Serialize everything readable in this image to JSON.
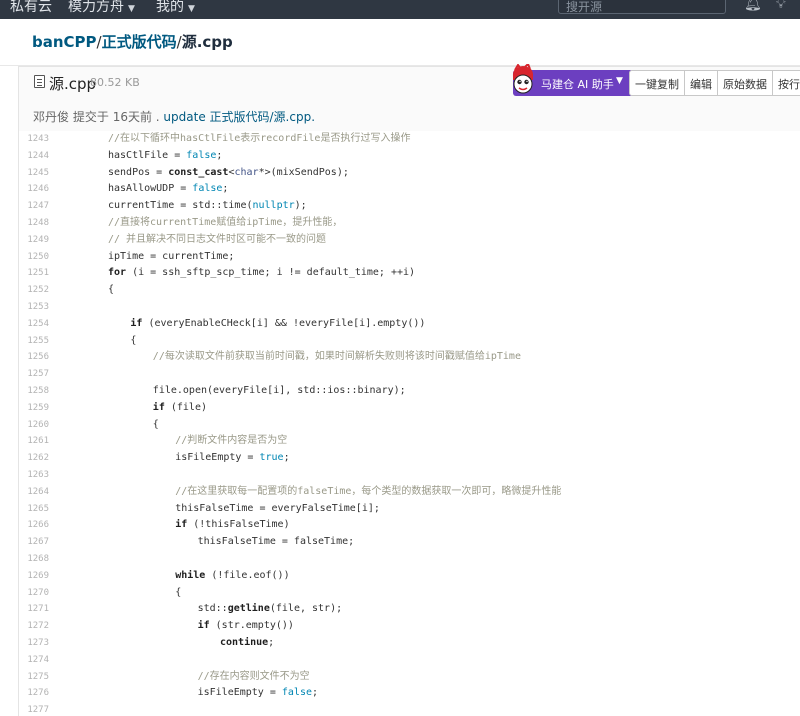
{
  "nav": {
    "items": [
      {
        "label": "私有云",
        "has_caret": false
      },
      {
        "label": "模力方舟",
        "has_caret": true
      },
      {
        "label": "我的",
        "has_caret": true
      }
    ],
    "search_placeholder": "搜开源",
    "icons": [
      "bell-icon",
      "lightbulb-icon"
    ]
  },
  "path": {
    "owner": "banCPP",
    "separator": "/",
    "folder": "正式版代码",
    "file": "源.cpp"
  },
  "file": {
    "name": "源.cpp",
    "size": "80.52 KB",
    "ai_button_label": "马建仓 AI 助手",
    "actions": [
      "一键复制",
      "编辑",
      "原始数据",
      "按行查看"
    ],
    "commit": {
      "author": "邓丹俊",
      "action": "提交于",
      "time": "16天前",
      "separator": " . ",
      "message": "update 正式版代码/源.cpp."
    }
  },
  "code_lines": [
    {
      "num": "1243",
      "tokens": [
        {
          "t": "//在以下循环中hasCtlFile表示recordFile是否执行过写入操作",
          "c": "cmt"
        }
      ],
      "indent": 0
    },
    {
      "num": "1244",
      "tokens": [
        {
          "t": "hasCtlFile = ",
          "c": ""
        },
        {
          "t": "false",
          "c": "bool"
        },
        {
          "t": ";",
          "c": ""
        }
      ],
      "indent": 0
    },
    {
      "num": "1245",
      "tokens": [
        {
          "t": "sendPos = ",
          "c": ""
        },
        {
          "t": "const_cast",
          "c": "kw"
        },
        {
          "t": "<",
          "c": ""
        },
        {
          "t": "char",
          "c": "kt"
        },
        {
          "t": "*>(mixSendPos);",
          "c": ""
        }
      ],
      "indent": 0
    },
    {
      "num": "1246",
      "tokens": [
        {
          "t": "hasAllowUDP = ",
          "c": ""
        },
        {
          "t": "false",
          "c": "bool"
        },
        {
          "t": ";",
          "c": ""
        }
      ],
      "indent": 0
    },
    {
      "num": "1247",
      "tokens": [
        {
          "t": "currentTime = std::time(",
          "c": ""
        },
        {
          "t": "nullptr",
          "c": "bool"
        },
        {
          "t": ");",
          "c": ""
        }
      ],
      "indent": 0
    },
    {
      "num": "1248",
      "tokens": [
        {
          "t": "//直接将currentTime赋值给ipTime，提升性能，",
          "c": "cmt"
        }
      ],
      "indent": 0
    },
    {
      "num": "1249",
      "tokens": [
        {
          "t": "// 并且解决不同日志文件时区可能不一致的问题",
          "c": "cmt"
        }
      ],
      "indent": 0
    },
    {
      "num": "1250",
      "tokens": [
        {
          "t": "ipTime = currentTime;",
          "c": ""
        }
      ],
      "indent": 0
    },
    {
      "num": "1251",
      "tokens": [
        {
          "t": "for",
          "c": "kw"
        },
        {
          "t": " (i = ssh_sftp_scp_time; i != default_time; ++i)",
          "c": ""
        }
      ],
      "indent": 0
    },
    {
      "num": "1252",
      "tokens": [
        {
          "t": "{",
          "c": ""
        }
      ],
      "indent": 0
    },
    {
      "num": "1253",
      "tokens": [],
      "indent": 0
    },
    {
      "num": "1254",
      "tokens": [
        {
          "t": "if",
          "c": "kw"
        },
        {
          "t": " (everyEnableCHeck[i] && !everyFile[i].empty())",
          "c": ""
        }
      ],
      "indent": 1
    },
    {
      "num": "1255",
      "tokens": [
        {
          "t": "{",
          "c": ""
        }
      ],
      "indent": 1
    },
    {
      "num": "1256",
      "tokens": [
        {
          "t": "//每次读取文件前获取当前时间戳，如果时间解析失败则将该时间戳赋值给ipTime",
          "c": "cmt"
        }
      ],
      "indent": 2
    },
    {
      "num": "1257",
      "tokens": [],
      "indent": 0
    },
    {
      "num": "1258",
      "tokens": [
        {
          "t": "file.open(everyFile[i], std::ios::binary);",
          "c": ""
        }
      ],
      "indent": 2
    },
    {
      "num": "1259",
      "tokens": [
        {
          "t": "if",
          "c": "kw"
        },
        {
          "t": " (file)",
          "c": ""
        }
      ],
      "indent": 2
    },
    {
      "num": "1260",
      "tokens": [
        {
          "t": "{",
          "c": ""
        }
      ],
      "indent": 2
    },
    {
      "num": "1261",
      "tokens": [
        {
          "t": "//判断文件内容是否为空",
          "c": "cmt"
        }
      ],
      "indent": 3
    },
    {
      "num": "1262",
      "tokens": [
        {
          "t": "isFileEmpty = ",
          "c": ""
        },
        {
          "t": "true",
          "c": "bool"
        },
        {
          "t": ";",
          "c": ""
        }
      ],
      "indent": 3
    },
    {
      "num": "1263",
      "tokens": [],
      "indent": 0
    },
    {
      "num": "1264",
      "tokens": [
        {
          "t": "//在这里获取每一配置项的falseTime，每个类型的数据获取一次即可，略微提升性能",
          "c": "cmt"
        }
      ],
      "indent": 3
    },
    {
      "num": "1265",
      "tokens": [
        {
          "t": "thisFalseTime = everyFalseTime[i];",
          "c": ""
        }
      ],
      "indent": 3
    },
    {
      "num": "1266",
      "tokens": [
        {
          "t": "if",
          "c": "kw"
        },
        {
          "t": " (!thisFalseTime)",
          "c": ""
        }
      ],
      "indent": 3
    },
    {
      "num": "1267",
      "tokens": [
        {
          "t": "thisFalseTime = falseTime;",
          "c": ""
        }
      ],
      "indent": 4
    },
    {
      "num": "1268",
      "tokens": [],
      "indent": 0
    },
    {
      "num": "1269",
      "tokens": [
        {
          "t": "while",
          "c": "kw"
        },
        {
          "t": " (!file.eof())",
          "c": ""
        }
      ],
      "indent": 3
    },
    {
      "num": "1270",
      "tokens": [
        {
          "t": "{",
          "c": ""
        }
      ],
      "indent": 3
    },
    {
      "num": "1271",
      "tokens": [
        {
          "t": "std::",
          "c": ""
        },
        {
          "t": "getline",
          "c": "kw"
        },
        {
          "t": "(file, str);",
          "c": ""
        }
      ],
      "indent": 4
    },
    {
      "num": "1272",
      "tokens": [
        {
          "t": "if",
          "c": "kw"
        },
        {
          "t": " (str.empty())",
          "c": ""
        }
      ],
      "indent": 4
    },
    {
      "num": "1273",
      "tokens": [
        {
          "t": "continue",
          "c": "kw"
        },
        {
          "t": ";",
          "c": ""
        }
      ],
      "indent": 5
    },
    {
      "num": "1274",
      "tokens": [],
      "indent": 0
    },
    {
      "num": "1275",
      "tokens": [
        {
          "t": "//存在内容则文件不为空",
          "c": "cmt"
        }
      ],
      "indent": 4
    },
    {
      "num": "1276",
      "tokens": [
        {
          "t": "isFileEmpty = ",
          "c": ""
        },
        {
          "t": "false",
          "c": "bool"
        },
        {
          "t": ";",
          "c": ""
        }
      ],
      "indent": 4
    },
    {
      "num": "1277",
      "tokens": [],
      "indent": 0
    }
  ]
}
